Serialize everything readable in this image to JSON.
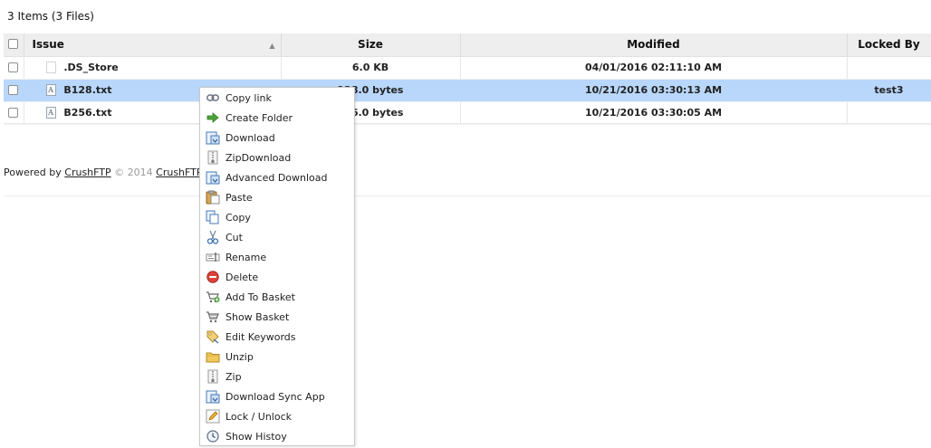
{
  "summary": "3 Items (3 Files)",
  "table": {
    "columns": {
      "issue": "Issue",
      "size": "Size",
      "modified": "Modified",
      "locked_by": "Locked By"
    },
    "sort_indicator": "▲",
    "rows": [
      {
        "name": ".DS_Store",
        "size": "6.0 KB",
        "modified": "04/01/2016 02:11:10 AM",
        "locked_by": "",
        "selected": false
      },
      {
        "name": "B128.txt",
        "size": "128.0 bytes",
        "modified": "10/21/2016 03:30:13 AM",
        "locked_by": "test3",
        "selected": true
      },
      {
        "name": "B256.txt",
        "size": "256.0 bytes",
        "modified": "10/21/2016 03:30:05 AM",
        "locked_by": "",
        "selected": false
      }
    ]
  },
  "footer": {
    "powered_by": "Powered by",
    "crushftp_link": "CrushFTP",
    "copyright": "© 2014",
    "crushftp_link2": "CrushFTP"
  },
  "context_menu": {
    "items": [
      {
        "label": "Copy link",
        "icon": "link-icon"
      },
      {
        "label": "Create Folder",
        "icon": "create-folder-icon"
      },
      {
        "label": "Download",
        "icon": "download-icon"
      },
      {
        "label": "ZipDownload",
        "icon": "zip-download-icon"
      },
      {
        "label": "Advanced Download",
        "icon": "advanced-download-icon"
      },
      {
        "label": "Paste",
        "icon": "paste-icon"
      },
      {
        "label": "Copy",
        "icon": "copy-icon"
      },
      {
        "label": "Cut",
        "icon": "scissors-icon"
      },
      {
        "label": "Rename",
        "icon": "rename-icon"
      },
      {
        "label": "Delete",
        "icon": "delete-icon"
      },
      {
        "label": "Add To Basket",
        "icon": "add-to-basket-icon"
      },
      {
        "label": "Show Basket",
        "icon": "basket-icon"
      },
      {
        "label": "Edit Keywords",
        "icon": "tag-icon"
      },
      {
        "label": "Unzip",
        "icon": "unzip-icon"
      },
      {
        "label": "Zip",
        "icon": "zip-icon"
      },
      {
        "label": "Download Sync App",
        "icon": "sync-app-icon"
      },
      {
        "label": "Lock / Unlock",
        "icon": "pencil-icon"
      },
      {
        "label": "Show Histoy",
        "icon": "history-icon"
      }
    ]
  },
  "colors": {
    "selected_row": "#b9d7fb",
    "header_bg": "#eeeeee",
    "delete_red": "#d9433a",
    "folder_green": "#4aa33a"
  }
}
